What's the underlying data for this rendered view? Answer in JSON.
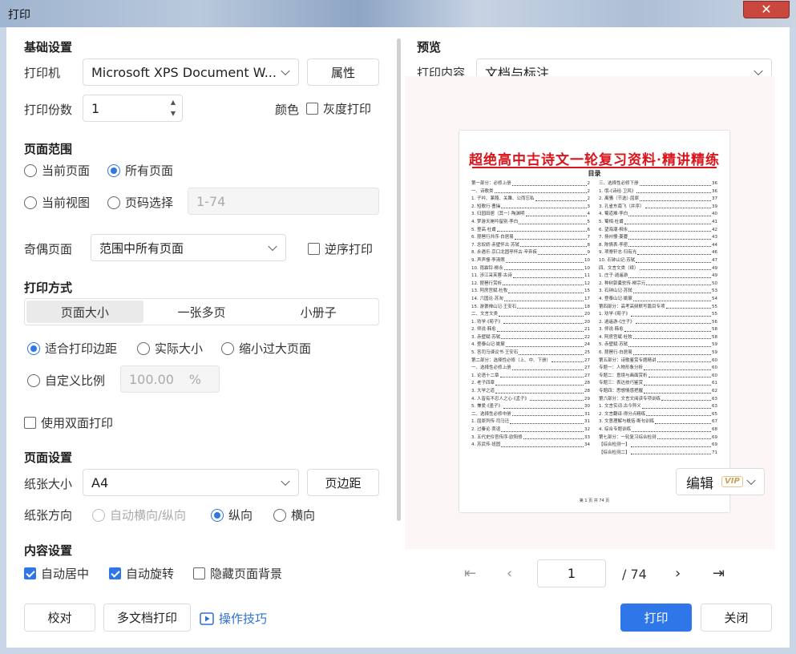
{
  "window": {
    "title": "打印",
    "close_label": "✕"
  },
  "basic": {
    "title": "基础设置",
    "printer_label": "打印机",
    "printer_value": "Microsoft XPS Document W...",
    "properties_button": "属性",
    "copies_label": "打印份数",
    "copies_value": "1",
    "color_label": "颜色",
    "grayscale_label": "灰度打印",
    "grayscale_checked": false
  },
  "page_range": {
    "title": "页面范围",
    "current_page": "当前页面",
    "all_pages": "所有页面",
    "current_view": "当前视图",
    "page_select": "页码选择",
    "page_select_placeholder": "1-74",
    "selected": "所有页面",
    "odd_even_label": "奇偶页面",
    "odd_even_value": "范围中所有页面",
    "reverse_label": "逆序打印",
    "reverse_checked": false
  },
  "print_mode": {
    "title": "打印方式",
    "tabs": [
      "页面大小",
      "一张多页",
      "小册子"
    ],
    "active_tab": "页面大小",
    "fit_margin": "适合打印边距",
    "actual_size": "实际大小",
    "shrink_large": "缩小过大页面",
    "custom_scale": "自定义比例",
    "scale_value": "100.00",
    "scale_unit": "%",
    "selected": "适合打印边距",
    "duplex_label": "使用双面打印",
    "duplex_checked": false
  },
  "page_setup": {
    "title": "页面设置",
    "paper_size_label": "纸张大小",
    "paper_size_value": "A4",
    "margin_button": "页边距",
    "orientation_label": "纸张方向",
    "auto_orientation": "自动横向/纵向",
    "portrait": "纵向",
    "landscape": "横向",
    "selected": "纵向"
  },
  "content_setup": {
    "title": "内容设置",
    "auto_center": "自动居中",
    "auto_center_checked": true,
    "auto_rotate": "自动旋转",
    "auto_rotate_checked": true,
    "hide_background": "隐藏页面背景",
    "hide_background_checked": false
  },
  "preview": {
    "title": "预览",
    "content_label": "打印内容",
    "content_value": "文档与标注",
    "doc_title": "超绝高中古诗文一轮复习资料·精讲精练",
    "doc_subtitle": "目录",
    "toc_left": [
      [
        "第一部分：必修上册",
        "2"
      ],
      [
        "一、诗歌类",
        "2"
      ],
      [
        "1. 子衿、蒹葭、关雎、公而忘私",
        "2"
      ],
      [
        "2. 短歌行·曹操",
        "3"
      ],
      [
        "3. 归园田居（其一）·陶渊明",
        "4"
      ],
      [
        "4. 梦游天姥吟留别·李白",
        "5"
      ],
      [
        "5. 登高·杜甫",
        "6"
      ],
      [
        "6. 琵琶行并序·白居易",
        "7"
      ],
      [
        "7. 念奴娇·赤壁怀古·苏轼",
        "8"
      ],
      [
        "8. 永遇乐·京口北固亭怀古·辛弃疾",
        "9"
      ],
      [
        "9. 声声慢·李清照",
        "10"
      ],
      [
        "10. 雨霖铃·柳永",
        "10"
      ],
      [
        "11. 涉江采芙蓉·古诗",
        "11"
      ],
      [
        "12. 琵琶行赏析",
        "12"
      ],
      [
        "13. 阿房宫赋·杜牧",
        "15"
      ],
      [
        "14. 六国论·苏洵",
        "17"
      ],
      [
        "15. 游褒禅山记·王安石",
        "18"
      ],
      [
        "二、文言文类",
        "20"
      ],
      [
        "1. 劝学·《荀子》",
        "20"
      ],
      [
        "2. 师说·韩愈",
        "21"
      ],
      [
        "3. 赤壁赋·苏轼",
        "22"
      ],
      [
        "4. 登泰山记·姚鼐",
        "24"
      ],
      [
        "5. 答司马谏议书·王安石",
        "25"
      ],
      [
        "第二部分：选择性必修（上、中、下册）",
        "27"
      ],
      [
        "一、选择性必修上册",
        "27"
      ],
      [
        "1. 论语十二章",
        "27"
      ],
      [
        "2. 老子四章",
        "28"
      ],
      [
        "3. 大学之道",
        "28"
      ],
      [
        "4. 人皆有不忍人之心·《孟子》",
        "29"
      ],
      [
        "5. 兼爱·《墨子》",
        "30"
      ],
      [
        "二、选择性必修中册",
        "31"
      ],
      [
        "1. 屈原列传·司马迁",
        "31"
      ],
      [
        "2. 过秦论·贾谊",
        "32"
      ],
      [
        "3. 五代史伶官传序·欧阳修",
        "33"
      ],
      [
        "4. 苏武传·班固",
        "34"
      ]
    ],
    "toc_right": [
      [
        "三、选择性必修下册",
        "36"
      ],
      [
        "1. 氓·《诗经·卫风》",
        "36"
      ],
      [
        "2. 离骚（节选）·屈原",
        "37"
      ],
      [
        "3. 孔雀东南飞（并序）",
        "39"
      ],
      [
        "4. 蜀道难·李白",
        "40"
      ],
      [
        "5. 蜀相·杜甫",
        "41"
      ],
      [
        "6. 望海潮·柳永",
        "42"
      ],
      [
        "7. 扬州慢·姜夔",
        "43"
      ],
      [
        "8. 陈情表·李密",
        "44"
      ],
      [
        "9. 项脊轩志·归有光",
        "46"
      ],
      [
        "10. 石钟山记·苏轼",
        "47"
      ],
      [
        "四、文言文类（续）",
        "49"
      ],
      [
        "1. 庄子·逍遥游",
        "49"
      ],
      [
        "2. 种树郭橐驼传·柳宗元",
        "50"
      ],
      [
        "3. 石钟山记·苏轼",
        "53"
      ],
      [
        "4. 登泰山记·姚鼐",
        "54"
      ],
      [
        "第四部分：高考高频默写篇目专项",
        "55"
      ],
      [
        "1. 劝学·《荀子》",
        "55"
      ],
      [
        "2. 逍遥游·《庄子》",
        "56"
      ],
      [
        "3. 师说·韩愈",
        "58"
      ],
      [
        "4. 阿房宫赋·杜牧",
        "58"
      ],
      [
        "5. 赤壁赋·苏轼",
        "59"
      ],
      [
        "6. 琵琶行·白居易",
        "59"
      ],
      [
        "第五部分：诗歌鉴赏专题精讲",
        "60"
      ],
      [
        "专题一：人物形象分析",
        "60"
      ],
      [
        "专题二：意境与画面赏析",
        "60"
      ],
      [
        "专题三：表达技巧鉴赏",
        "61"
      ],
      [
        "专题四：思想情感把握",
        "62"
      ],
      [
        "第六部分：文言文阅读专项训练",
        "63"
      ],
      [
        "1. 文言实词·古今异义",
        "63"
      ],
      [
        "2. 文言翻译·得分点精练",
        "65"
      ],
      [
        "3. 文意理解与概括·断句训练",
        "67"
      ],
      [
        "4. 综合专题训练",
        "68"
      ],
      [
        "第七部分：一轮复习综合检测",
        "69"
      ],
      [
        "【综合检测一】",
        "69"
      ],
      [
        "【综合检测二】",
        "71"
      ]
    ],
    "page_footer": "第 1 页 共 74 页",
    "edit_button": "编辑",
    "vip_badge": "VIP",
    "current_page": "1",
    "total_pages": "/ 74"
  },
  "footer": {
    "proofread_button": "校对",
    "multi_doc_button": "多文档打印",
    "tips_link": "操作技巧",
    "print_button": "打印",
    "close_button": "关闭"
  }
}
